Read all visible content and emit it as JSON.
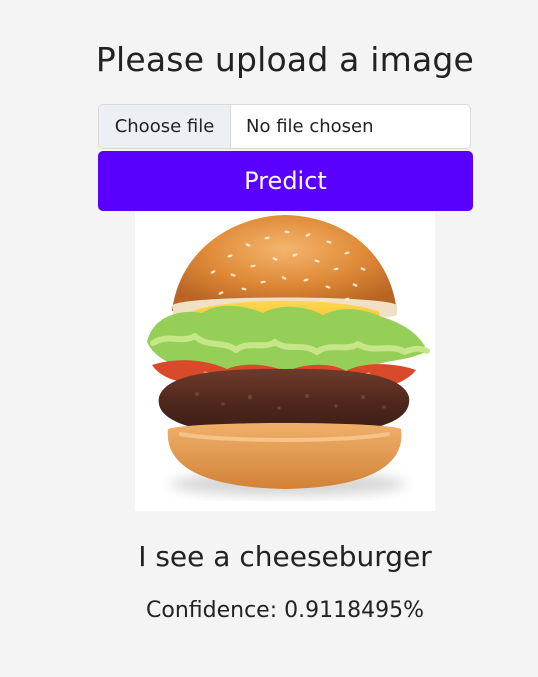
{
  "page": {
    "title": "Please upload a image"
  },
  "upload": {
    "choose_label": "Choose file",
    "status_text": "No file chosen"
  },
  "actions": {
    "predict_label": "Predict"
  },
  "preview": {
    "icon": "burger-image"
  },
  "prediction": {
    "result_text": "I see a cheeseburger",
    "confidence_text": "Confidence: 0.9118495%"
  },
  "colors": {
    "background": "#f4f4f4",
    "button": "#5a00ff",
    "text": "#222222"
  }
}
